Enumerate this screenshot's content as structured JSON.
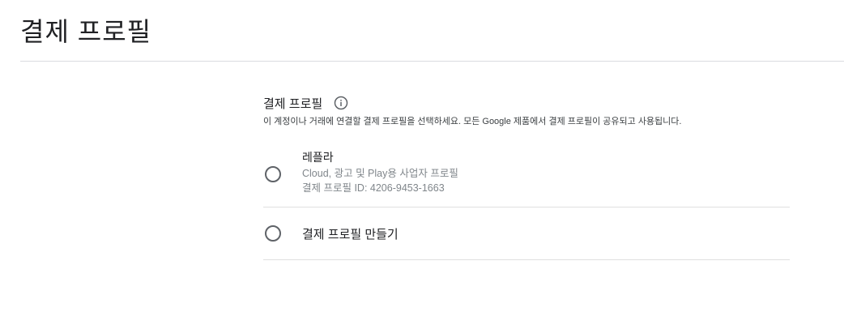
{
  "page": {
    "title": "결제 프로필"
  },
  "section": {
    "title": "결제 프로필",
    "info_icon": "info-circle-icon",
    "description": "이 계정이나 거래에 연결할 결제 프로필을 선택하세요. 모든 Google 제품에서 결제 프로필이 공유되고 사용됩니다."
  },
  "options": [
    {
      "name": "레플라",
      "subtitle": "Cloud, 광고 및 Play용 사업자 프로필",
      "profile_id": "결제 프로필 ID: 4206-9453-1663",
      "selected": false
    }
  ],
  "create_option": {
    "label": "결제 프로필 만들기",
    "selected": false
  },
  "colors": {
    "divider": "#dadce0",
    "secondary_text": "#80868b",
    "radio_border": "#5f6368"
  }
}
